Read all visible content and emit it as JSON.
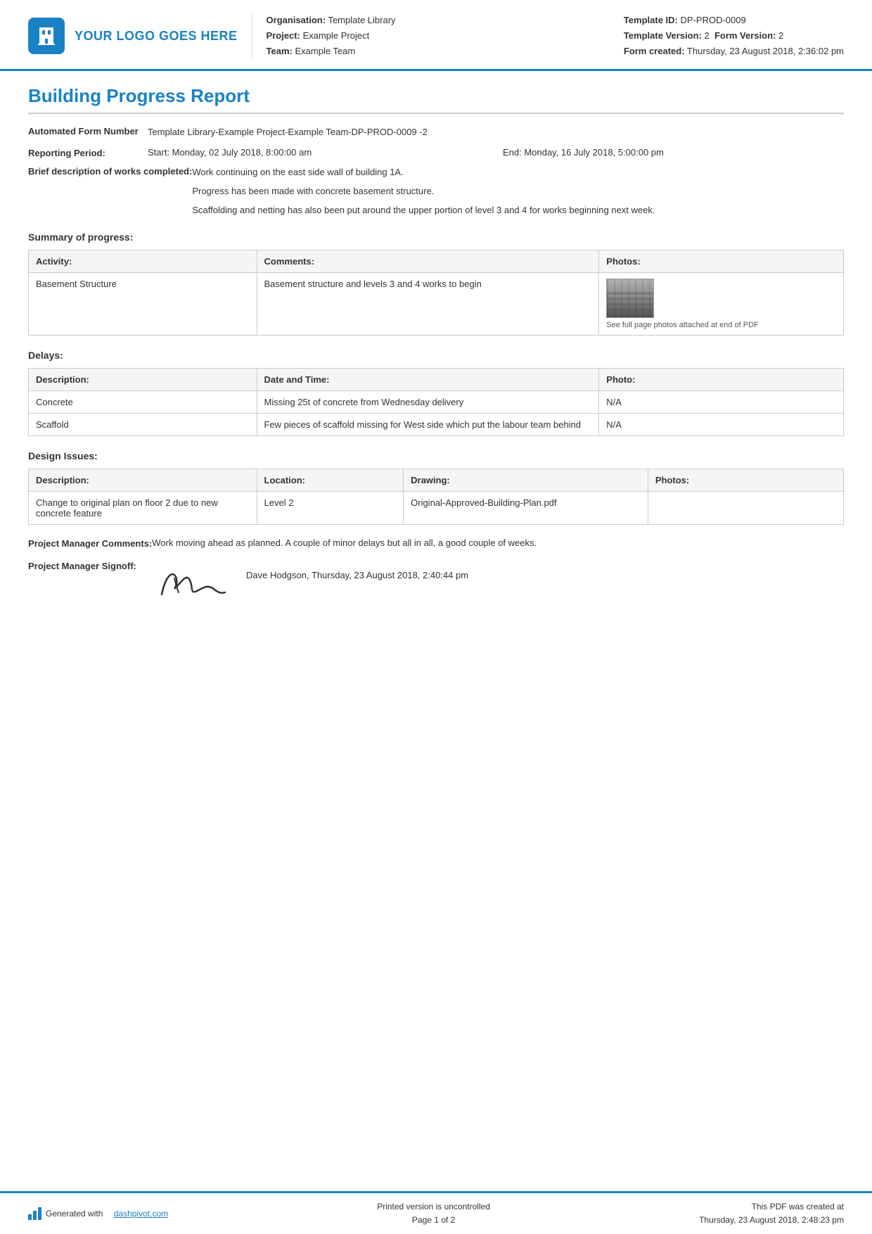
{
  "header": {
    "logo_text": "YOUR LOGO GOES HERE",
    "org_label": "Organisation:",
    "org_value": "Template Library",
    "project_label": "Project:",
    "project_value": "Example Project",
    "team_label": "Team:",
    "team_value": "Example Team",
    "template_id_label": "Template ID:",
    "template_id_value": "DP-PROD-0009",
    "template_version_label": "Template Version:",
    "template_version_value": "2",
    "form_version_label": "Form Version:",
    "form_version_value": "2",
    "form_created_label": "Form created:",
    "form_created_value": "Thursday, 23 August 2018, 2:36:02 pm"
  },
  "report": {
    "title": "Building Progress Report",
    "auto_form_number_label": "Automated Form Number",
    "auto_form_number_value": "Template Library-Example Project-Example Team-DP-PROD-0009   -2",
    "reporting_period_label": "Reporting Period:",
    "period_start": "Start: Monday, 02 July 2018, 8:00:00 am",
    "period_end": "End: Monday, 16 July 2018, 5:00:00 pm",
    "brief_desc_label": "Brief description of works completed:",
    "brief_desc_lines": [
      "Work continuing on the east side wall of building 1A.",
      "Progress has been made with concrete basement structure.",
      "Scaffolding and netting has also been put around the upper portion of level 3 and 4 for works beginning next week."
    ]
  },
  "summary": {
    "heading": "Summary of progress:",
    "table_headers": [
      "Activity:",
      "Comments:",
      "Photos:"
    ],
    "rows": [
      {
        "activity": "Basement Structure",
        "comments": "Basement structure and levels 3 and 4 works to begin",
        "photo_caption": "See full page photos attached at end of PDF"
      }
    ]
  },
  "delays": {
    "heading": "Delays:",
    "table_headers": [
      "Description:",
      "Date and Time:",
      "Photo:"
    ],
    "rows": [
      {
        "description": "Concrete",
        "date_time": "Missing 25t of concrete from Wednesday delivery",
        "photo": "N/A"
      },
      {
        "description": "Scaffold",
        "date_time": "Few pieces of scaffold missing for West side which put the labour team behind",
        "photo": "N/A"
      }
    ]
  },
  "design_issues": {
    "heading": "Design Issues:",
    "table_headers": [
      "Description:",
      "Location:",
      "Drawing:",
      "Photos:"
    ],
    "rows": [
      {
        "description": "Change to original plan on floor 2 due to new concrete feature",
        "location": "Level 2",
        "drawing": "Original-Approved-Building-Plan.pdf",
        "photos": ""
      }
    ]
  },
  "project_manager": {
    "comments_label": "Project Manager Comments:",
    "comments_value": "Work moving ahead as planned. A couple of minor delays but all in all, a good couple of weeks.",
    "signoff_label": "Project Manager Signoff:",
    "signoff_person": "Dave Hodgson, Thursday, 23 August 2018, 2:40:44 pm"
  },
  "footer": {
    "generated_text": "Generated with",
    "generated_link": "dashpivot.com",
    "page_label": "Printed version is uncontrolled",
    "page_number": "Page 1 of 2",
    "pdf_created_label": "This PDF was created at",
    "pdf_created_value": "Thursday, 23 August 2018, 2:48:23 pm"
  }
}
